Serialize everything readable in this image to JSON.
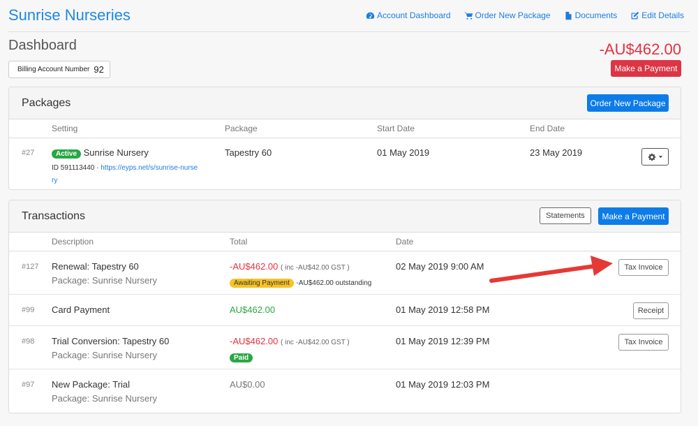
{
  "brand": "Sunrise Nurseries",
  "nav": [
    {
      "label": "Account Dashboard",
      "icon": "dashboard-icon"
    },
    {
      "label": "Order New Package",
      "icon": "cart-icon"
    },
    {
      "label": "Documents",
      "icon": "document-icon"
    },
    {
      "label": "Edit Details",
      "icon": "edit-icon"
    }
  ],
  "dashboard": {
    "title": "Dashboard",
    "billing_label": "Billing Account Number",
    "billing_number": "92",
    "balance": "-AU$462.00",
    "make_payment": "Make a Payment"
  },
  "packages": {
    "title": "Packages",
    "order_button": "Order New Package",
    "columns": [
      "Setting",
      "Package",
      "Start Date",
      "End Date"
    ],
    "rows": [
      {
        "id": "#27",
        "status": "Active",
        "name": "Sunrise Nursery",
        "setting_id": "ID 591113440",
        "sep": " · ",
        "url_line1": "https://eyps.net/s/sunrise-nurse",
        "url_line2": "ry",
        "package": "Tapestry 60",
        "start": "01 May 2019",
        "end": "23 May 2019"
      }
    ]
  },
  "transactions": {
    "title": "Transactions",
    "statements_button": "Statements",
    "payment_button": "Make a Payment",
    "columns": [
      "Description",
      "Total",
      "Date"
    ],
    "rows": [
      {
        "id": "#127",
        "desc": "Renewal: Tapestry 60",
        "sub": "Package: Sunrise Nursery",
        "total": "-AU$462.00",
        "gst": "( inc -AU$42.00 GST )",
        "status": "Awaiting Payment",
        "note": "-AU$462.00 outstanding",
        "date": "02 May 2019 9:00 AM",
        "action": "Tax Invoice"
      },
      {
        "id": "#99",
        "desc": "Card Payment",
        "total": "AU$462.00",
        "date": "01 May 2019 12:58 PM",
        "action": "Receipt"
      },
      {
        "id": "#98",
        "desc": "Trial Conversion: Tapestry 60",
        "sub": "Package: Sunrise Nursery",
        "total": "-AU$462.00",
        "gst": "( inc -AU$42.00 GST )",
        "status": "Paid",
        "date": "01 May 2019 12:39 PM",
        "action": "Tax Invoice"
      },
      {
        "id": "#97",
        "desc": "New Package: Trial",
        "sub": "Package: Sunrise Nursery",
        "total": "AU$0.00",
        "date": "01 May 2019 12:03 PM"
      }
    ]
  },
  "colors": {
    "accent": "#1e88e5",
    "danger": "#dc3545",
    "success": "#28a745",
    "warning": "#f7c325",
    "annotation": "#e53935"
  }
}
